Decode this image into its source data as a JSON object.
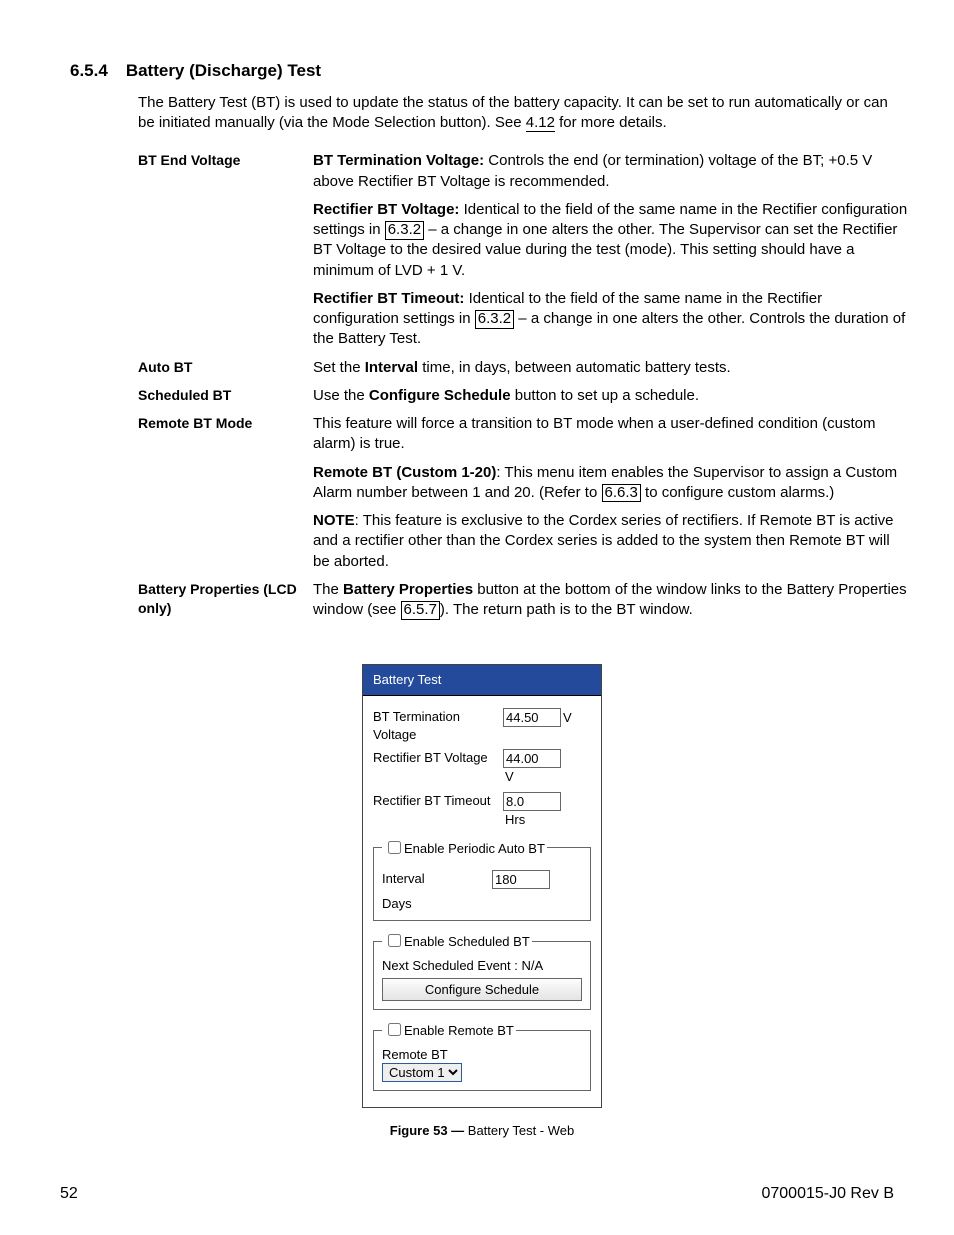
{
  "section": {
    "number": "6.5.4",
    "title": "Battery (Discharge) Test",
    "intro_a": "The Battery Test (BT) is used to update the status of the battery capacity. It can be set to run automatically or can be initiated manually (via the Mode Selection button). See ",
    "intro_xref": "4.12",
    "intro_b": " for more details."
  },
  "defs": {
    "bt_end_voltage_label": "BT End Voltage",
    "bt_term_title": "BT Termination Voltage:",
    "bt_term_text": " Controls the end (or termination) voltage of the BT; +0.5 V above Rectifier BT Voltage is recommended.",
    "rect_bt_voltage_title": "Rectifier BT Voltage:",
    "rect_bt_voltage_a": " Identical to the field of the same name in the Rectifier configuration settings in ",
    "rect_bt_voltage_xref": "6.3.2",
    "rect_bt_voltage_b": " – a change in one alters the other. The Supervisor can set the Rectifier BT Voltage to the desired value during the test (mode). This setting should have a minimum of LVD + 1 V.",
    "rect_bt_timeout_title": "Rectifier BT Timeout:",
    "rect_bt_timeout_a": " Identical to the field of the same name in the Rectifier configuration settings in ",
    "rect_bt_timeout_xref": "6.3.2",
    "rect_bt_timeout_b": "  – a change in one alters the other. Controls the duration of the Battery Test.",
    "auto_bt_label": "Auto BT",
    "auto_bt_a": "Set the ",
    "auto_bt_bold": "Interval",
    "auto_bt_b": " time, in days, between automatic battery tests.",
    "sched_bt_label": "Scheduled BT",
    "sched_bt_a": "Use the ",
    "sched_bt_bold": "Configure Schedule",
    "sched_bt_b": " button to set up a schedule.",
    "remote_bt_label": "Remote BT Mode",
    "remote_bt_intro": "This feature will force a transition to BT mode when a user-defined condition (custom alarm) is true.",
    "remote_bt_custom_title": "Remote BT (Custom 1-20)",
    "remote_bt_custom_a": ": This menu item enables the Supervisor to assign a Custom Alarm number between 1 and 20. (Refer to ",
    "remote_bt_custom_xref": "6.6.3",
    "remote_bt_custom_b": " to configure custom alarms.)",
    "note_title": "NOTE",
    "note_text": ":  This feature is exclusive to the Cordex series of rectifiers. If Remote BT is active and a rectifier other than the Cordex series is added to the system then Remote BT will be aborted.",
    "bprop_label": "Battery Properties (LCD only)",
    "bprop_a": "The ",
    "bprop_bold": "Battery Properties",
    "bprop_b": " button at the bottom of the window links to the Battery Properties window (see ",
    "bprop_xref": "6.5.7",
    "bprop_c": "). The return path is to the BT window."
  },
  "panel": {
    "title": "Battery Test",
    "bt_term_label": "BT Termination Voltage",
    "bt_term_value": "44.50",
    "bt_term_unit": "V",
    "rect_bt_v_label": "Rectifier BT Voltage",
    "rect_bt_v_value": "44.00",
    "rect_bt_v_unit": "V",
    "rect_bt_t_label": "Rectifier BT Timeout",
    "rect_bt_t_value": "8.0",
    "rect_bt_t_unit": "Hrs",
    "grp_auto_legend": "Enable Periodic Auto BT",
    "grp_auto_interval_label": "Interval",
    "grp_auto_interval_value": "180",
    "grp_auto_days": "Days",
    "grp_sched_legend": "Enable Scheduled BT",
    "grp_sched_next": "Next Scheduled Event : N/A",
    "grp_sched_btn": "Configure Schedule",
    "grp_remote_legend": "Enable Remote BT",
    "grp_remote_label": "Remote BT",
    "grp_remote_option": "Custom 1"
  },
  "figure": {
    "caption_bold": "Figure 53  —  ",
    "caption_text": "Battery Test - Web"
  },
  "footer": {
    "page": "52",
    "docid": "0700015-J0    Rev B"
  }
}
